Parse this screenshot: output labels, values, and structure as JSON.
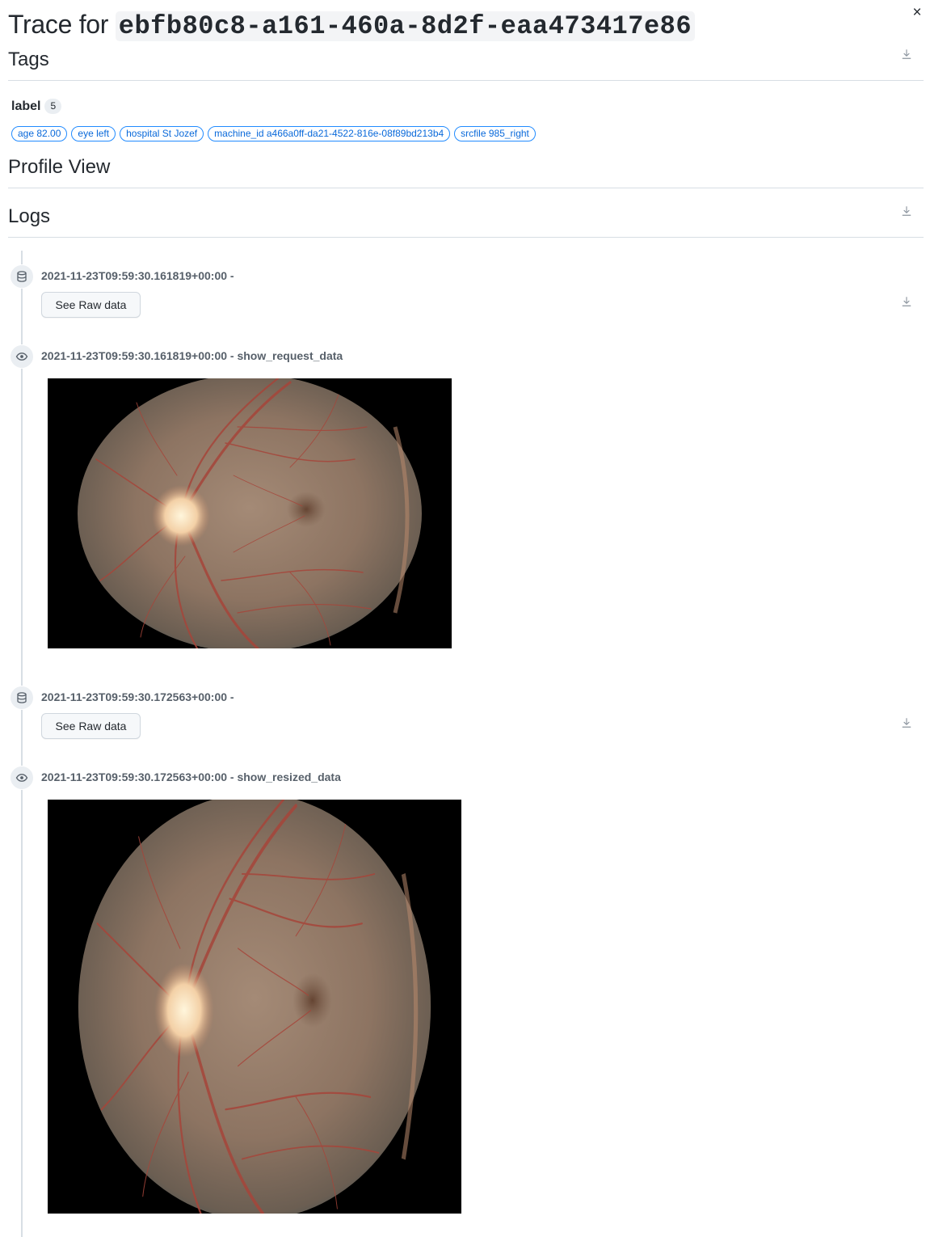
{
  "header": {
    "title_prefix": "Trace for",
    "trace_id": "ebfb80c8-a161-460a-8d2f-eaa473417e86",
    "close_glyph": "×",
    "close_icon": "close-icon"
  },
  "tags_section": {
    "heading": "Tags",
    "download_icon": "download-icon",
    "label": "label",
    "count": "5",
    "tags": [
      "age 82.00",
      "eye left",
      "hospital St Jozef",
      "machine_id a466a0ff-da21-4522-816e-08f89bd213b4",
      "srcfile 985_right"
    ]
  },
  "profile_section": {
    "heading": "Profile View"
  },
  "logs_section": {
    "heading": "Logs",
    "download_icon": "download-icon",
    "entries": [
      {
        "icon": "database-icon",
        "title": "2021-11-23T09:59:30.161819+00:00 -",
        "button_label": "See Raw data"
      },
      {
        "icon": "eye-icon",
        "title": "2021-11-23T09:59:30.161819+00:00 - show_request_data",
        "image": "retinal-fundus-image"
      },
      {
        "icon": "database-icon",
        "title": "2021-11-23T09:59:30.172563+00:00 -",
        "button_label": "See Raw data"
      },
      {
        "icon": "eye-icon",
        "title": "2021-11-23T09:59:30.172563+00:00 - show_resized_data",
        "image": "retinal-fundus-image"
      }
    ]
  },
  "colors": {
    "tag_border": "#218bff",
    "tag_text": "#0969da",
    "divider": "#d8dee4",
    "fundus_base": "#8d7462",
    "optic_disc": "#f3d0a6",
    "vessel": "#a6453a"
  }
}
